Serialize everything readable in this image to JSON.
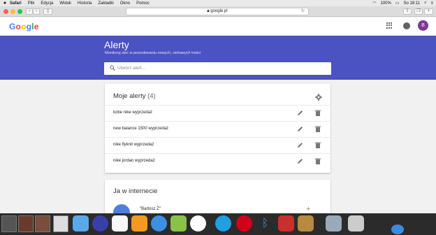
{
  "menubar": {
    "apple": "",
    "items": [
      "Safari",
      "Plik",
      "Edycja",
      "Widok",
      "Historia",
      "Zakładki",
      "Okno",
      "Pomoc"
    ],
    "battery": "100%",
    "time": "So 18:11"
  },
  "browser": {
    "url": "google.pl",
    "reload": "↻",
    "back": "‹",
    "forward": "›"
  },
  "gbar": {
    "logo": [
      "G",
      "o",
      "o",
      "g",
      "l",
      "e"
    ],
    "logo_colors": [
      "#4285f4",
      "#ea4335",
      "#fbbc05",
      "#4285f4",
      "#34a853",
      "#ea4335"
    ],
    "avatar_letter": "B"
  },
  "hero": {
    "title": "Alerty",
    "subtitle": "Monitoruj sieć w poszukiwaniu nowych, ciekawych treści",
    "search_placeholder": "Utwórz alert..."
  },
  "alerts": {
    "title": "Moje alerty",
    "count": "(4)",
    "items": [
      {
        "label": "kobe nike wyprzedaż"
      },
      {
        "label": "new balance 1500 wyprzedaż"
      },
      {
        "label": "nike flyknit wyprzedaż"
      },
      {
        "label": "nike jordan wyprzedaż"
      }
    ]
  },
  "me": {
    "title": "Ja w internecie",
    "person_name": "\"Bartosz Ż\"",
    "plus": "+"
  },
  "colors": {
    "hero": "#4b52c1",
    "avatar": "#7e3794"
  }
}
